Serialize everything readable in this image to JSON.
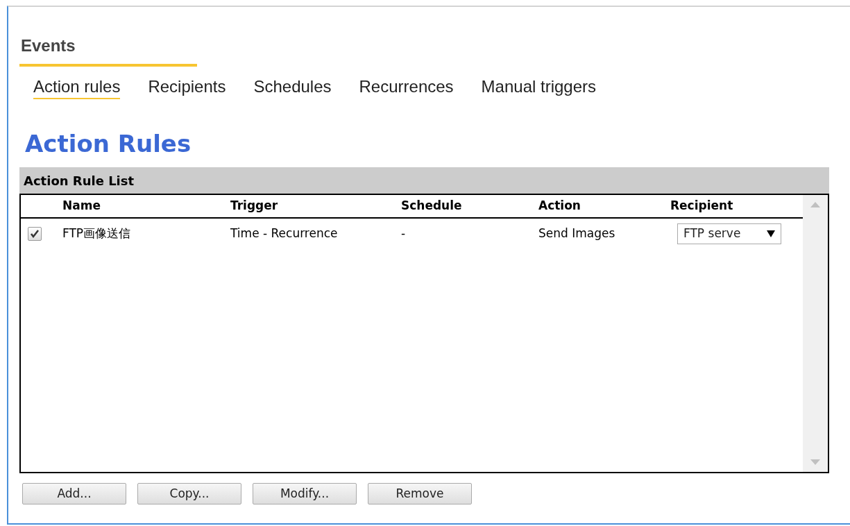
{
  "section_title": "Events",
  "tabs": [
    {
      "label": "Action rules",
      "selected": true
    },
    {
      "label": "Recipients",
      "selected": false
    },
    {
      "label": "Schedules",
      "selected": false
    },
    {
      "label": "Recurrences",
      "selected": false
    },
    {
      "label": "Manual triggers",
      "selected": false
    }
  ],
  "page_title": "Action Rules",
  "list": {
    "title": "Action Rule List",
    "columns": [
      "Name",
      "Trigger",
      "Schedule",
      "Action",
      "Recipient"
    ],
    "rows": [
      {
        "checked": true,
        "name": "FTP画像送信",
        "trigger": "Time - Recurrence",
        "schedule": "-",
        "action": "Send Images",
        "recipient": "FTP serve"
      }
    ]
  },
  "buttons": [
    "Add...",
    "Copy...",
    "Modify...",
    "Remove"
  ]
}
